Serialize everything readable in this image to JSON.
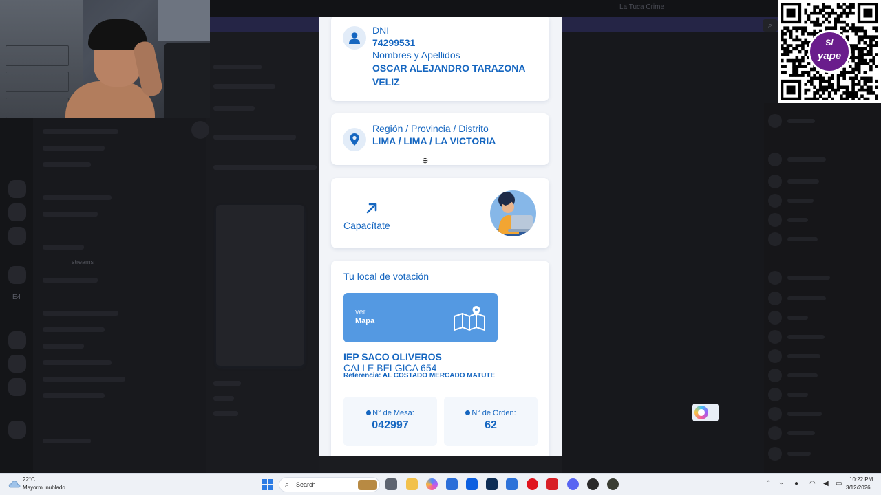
{
  "background": {
    "window_title": "La Tuca Crime",
    "channel_label": "streams",
    "side_tag": "E4"
  },
  "card_identity": {
    "dni_label": "DNI",
    "dni_value": "74299531",
    "names_label": "Nombres y Apellidos",
    "names_value": "OSCAR ALEJANDRO TARAZONA VELIZ",
    "icon": "person-icon"
  },
  "card_location": {
    "label": "Región / Provincia / Distrito",
    "value": "LIMA / LIMA / LA VICTORIA",
    "icon": "map-pin-icon"
  },
  "card_training": {
    "label": "Capacítate",
    "icon": "arrow-up-right-icon"
  },
  "card_voting": {
    "title": "Tu local de votación",
    "map_button": {
      "small": "ver",
      "big": "Mapa",
      "icon": "map-icon"
    },
    "place_name": "IEP SACO OLIVEROS",
    "address": "CALLE BELGICA 654",
    "reference": "Referencia: AL COSTADO MERCADO MATUTE",
    "mesa_label": "N° de Mesa:",
    "mesa_value": "042997",
    "orden_label": "N° de Orden:",
    "orden_value": "62"
  },
  "qr": {
    "badge_top": "S/",
    "badge_brand": "yape"
  },
  "taskbar": {
    "weather_temp": "22°C",
    "weather_desc": "Mayorm. nublado",
    "search_placeholder": "Search",
    "time": "10:22 PM",
    "date": "3/12/2026"
  },
  "colors": {
    "accent": "#1566c0",
    "map_button": "#5499e2",
    "card_bg": "#ffffff",
    "screen_bg": "#f2f4f8"
  }
}
